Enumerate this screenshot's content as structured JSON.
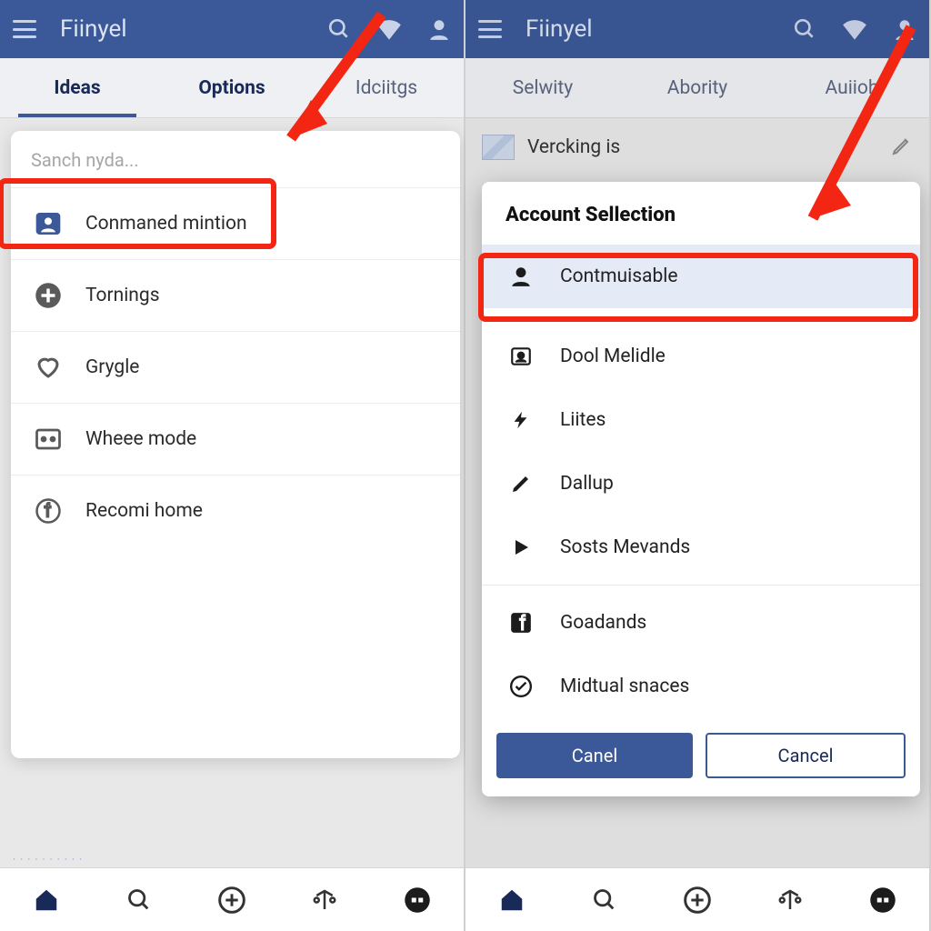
{
  "left": {
    "app_title": "Fiinyel",
    "tabs": [
      "Ideas",
      "Options",
      "Idciitgs"
    ],
    "search_placeholder": "Sanch nyda...",
    "items": [
      {
        "label": "Conmaned mintion"
      },
      {
        "label": "Tornings"
      },
      {
        "label": "Grygle"
      },
      {
        "label": "Wheee mode"
      },
      {
        "label": "Recomi home"
      }
    ]
  },
  "right": {
    "app_title": "Fiinyel",
    "tabs": [
      "Selwity",
      "Abority",
      "Auiioh"
    ],
    "header_text": "Vercking is",
    "dialog_title": "Account Sellection",
    "dialog_items": [
      {
        "label": "Contmuisable"
      },
      {
        "label": "Dool Melidle"
      },
      {
        "label": "Liites"
      },
      {
        "label": "Dallup"
      },
      {
        "label": "Sosts Mevands"
      },
      {
        "label": "Goadands"
      },
      {
        "label": "Midtual snaces"
      }
    ],
    "btn_primary": "Canel",
    "btn_secondary": "Cancel"
  }
}
